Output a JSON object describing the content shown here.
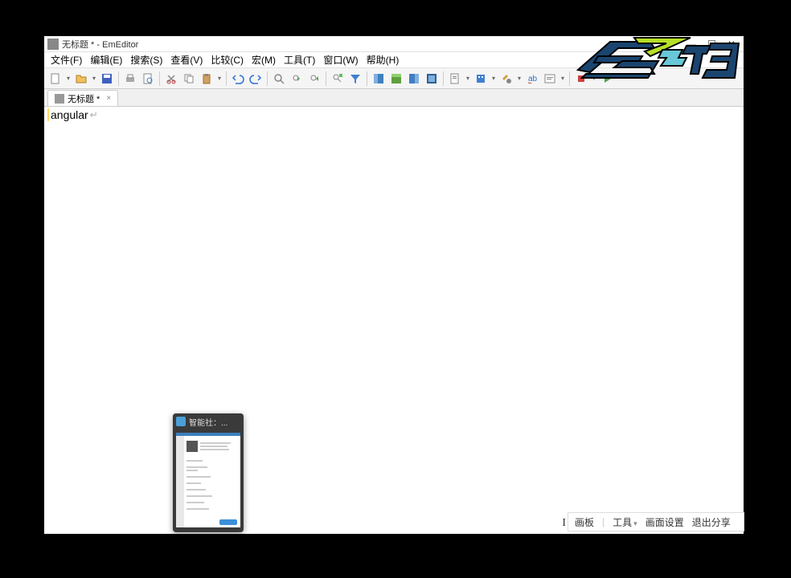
{
  "window": {
    "title": "无标题 * - EmEditor"
  },
  "menu": {
    "file": "文件(F)",
    "edit": "编辑(E)",
    "search": "搜索(S)",
    "view": "查看(V)",
    "compare": "比较(C)",
    "macro": "宏(M)",
    "tool": "工具(T)",
    "win": "窗口(W)",
    "help": "帮助(H)"
  },
  "tab": {
    "name": "无标题 *"
  },
  "editor": {
    "content": "angular",
    "eol": "↵"
  },
  "preview": {
    "title": "智能社：..."
  },
  "bottombar": {
    "board": "画板",
    "tool": "工具",
    "toolcaret": "▾",
    "setting": "画面设置",
    "exit": "退出分享"
  },
  "wincontrols": {
    "min": "—",
    "max": "☐",
    "close": "✕"
  }
}
